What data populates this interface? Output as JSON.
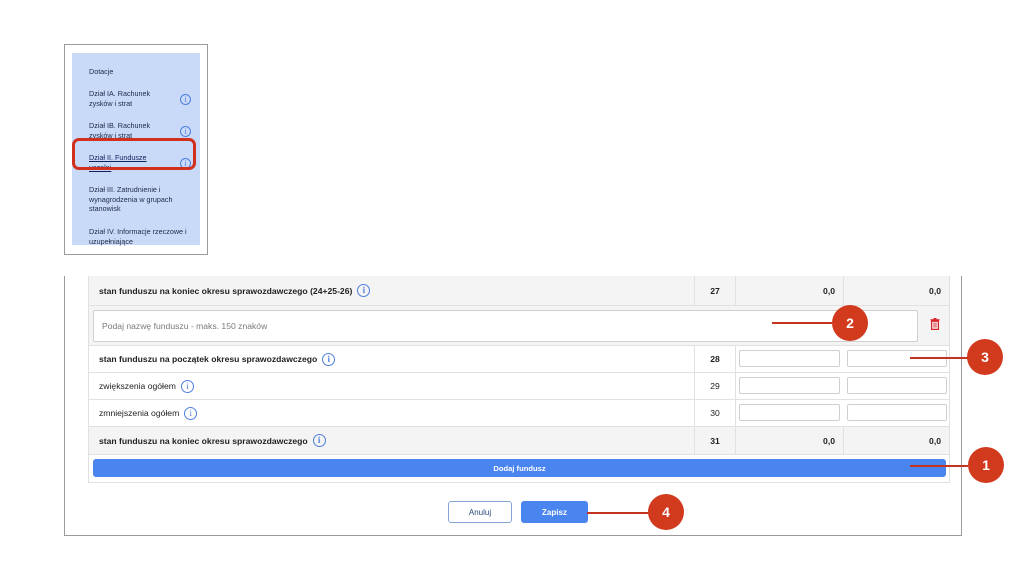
{
  "sidebar": {
    "items": [
      {
        "label": "Dotacje",
        "info": false,
        "active": false
      },
      {
        "label": "Dział IA. Rachunek zysków i strat",
        "info": true,
        "active": false
      },
      {
        "label": "Dział IB. Rachunek zysków i strat",
        "info": true,
        "active": false
      },
      {
        "label": "Dział II. Fundusze uczelni",
        "info": true,
        "active": true
      },
      {
        "label": "Dział III. Zatrudnienie i wynagrodzenia w grupach stanowisk",
        "info": false,
        "active": false
      },
      {
        "label": "Dział IV. Informacje rzeczowe i uzupełniające",
        "info": false,
        "active": false
      }
    ],
    "info_glyph": "i"
  },
  "table": {
    "top_row": {
      "label": "stan funduszu na koniec okresu sprawozdawczego (24+25-26)",
      "num": "27",
      "v1": "0,0",
      "v2": "0,0"
    },
    "fund_name_placeholder": "Podaj nazwę funduszu - maks. 150 znaków",
    "rows": [
      {
        "label": "stan funduszu na początek okresu sprawozdawczego",
        "num": "28",
        "bold": true
      },
      {
        "label": "zwiększenia ogółem",
        "num": "29",
        "bold": false
      },
      {
        "label": "zmniejszenia ogółem",
        "num": "30",
        "bold": false
      }
    ],
    "bottom_row": {
      "label": "stan funduszu na koniec okresu sprawozdawczego",
      "num": "31",
      "v1": "0,0",
      "v2": "0,0"
    }
  },
  "actions": {
    "add_fund": "Dodaj fundusz",
    "cancel": "Anuluj",
    "save": "Zapisz"
  },
  "callouts": [
    "1",
    "2",
    "3",
    "4"
  ],
  "colors": {
    "accent": "#4a84ef",
    "callout": "#d13a1d",
    "sidebar_bg": "#c9d9f8",
    "delete": "#d9262c"
  },
  "icons": [
    "info-icon",
    "trash-icon"
  ]
}
